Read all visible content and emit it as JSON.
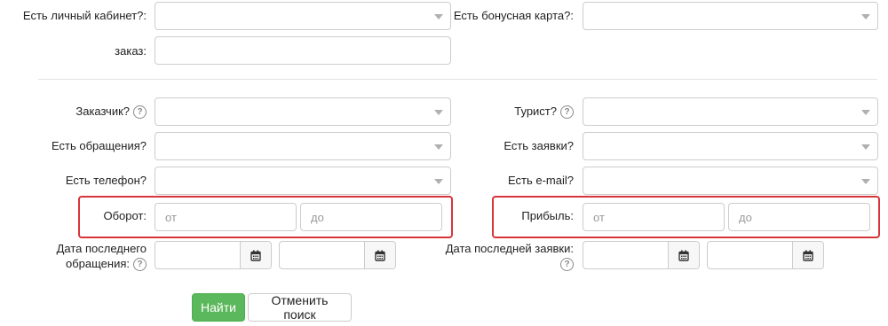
{
  "top": {
    "personal_cabinet_label": "Есть личный кабинет?:",
    "bonus_card_label": "Есть бонусная карта?:",
    "order_label": "заказ:"
  },
  "fields": {
    "customer_label": "Заказчик?",
    "tourist_label": "Турист?",
    "has_appeals_label": "Есть обращения?",
    "has_requests_label": "Есть заявки?",
    "has_phone_label": "Есть телефон?",
    "has_email_label": "Есть e-mail?",
    "turnover_label": "Оборот:",
    "profit_label": "Прибыль:",
    "from_placeholder": "от",
    "to_placeholder": "до",
    "last_appeal_date_label_line1": "Дата последнего",
    "last_appeal_date_label_line2": "обращения:",
    "last_request_date_label": "Дата последней заявки:",
    "help_glyph": "?"
  },
  "buttons": {
    "find": "Найти",
    "cancel_search": "Отменить поиск"
  },
  "colors": {
    "highlight": "#d8353a",
    "primary_green": "#5cb85c"
  }
}
